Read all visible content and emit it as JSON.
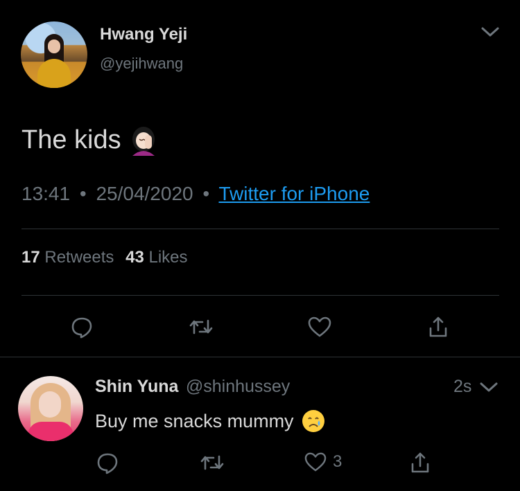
{
  "tweet": {
    "display_name": "Hwang Yeji",
    "handle": "@yejihwang",
    "text": "The kids",
    "emoji": "facepalm-emoji",
    "time": "13:41",
    "separator": "•",
    "date": "25/04/2020",
    "source": "Twitter for iPhone",
    "retweets_count": "17",
    "retweets_label": "Retweets",
    "likes_count": "43",
    "likes_label": "Likes",
    "actions": [
      "reply-icon",
      "retweet-icon",
      "like-icon",
      "share-icon"
    ]
  },
  "reply": {
    "display_name": "Shin Yuna",
    "handle": "@shinhussey",
    "time_ago": "2s",
    "text": "Buy me snacks mummy",
    "emoji": "crying-face-emoji",
    "like_count": "3"
  },
  "colors": {
    "background": "#000000",
    "text": "#d9d9d9",
    "muted": "#6e767d",
    "link": "#1d9bf0",
    "divider": "#2f3336"
  }
}
